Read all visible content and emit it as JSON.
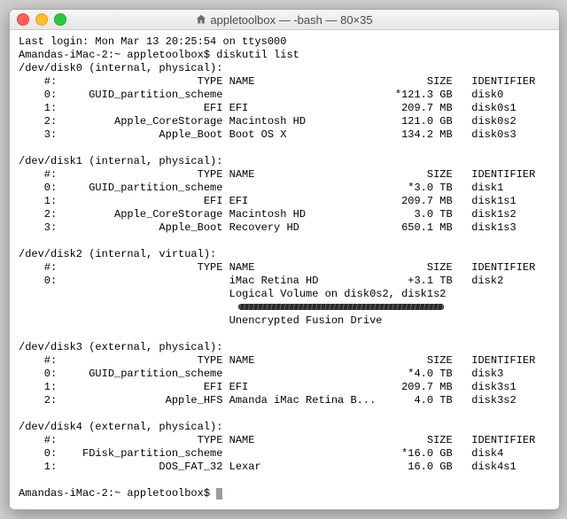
{
  "window": {
    "title": "appletoolbox — -bash — 80×35"
  },
  "login_line": "Last login: Mon Mar 13 20:25:54 on ttys000",
  "prompt_prefix": "Amandas-iMac-2:~ appletoolbox$",
  "command": "diskutil list",
  "header_cols": {
    "num": "#:",
    "type": "TYPE",
    "name": "NAME",
    "size": "SIZE",
    "ident": "IDENTIFIER"
  },
  "disks": [
    {
      "device": "/dev/disk0 (internal, physical):",
      "rows": [
        {
          "num": "0:",
          "type": "GUID_partition_scheme",
          "name": "",
          "star": "*",
          "size": "121.3 GB",
          "ident": "disk0"
        },
        {
          "num": "1:",
          "type": "EFI",
          "name": "EFI",
          "star": " ",
          "size": "209.7 MB",
          "ident": "disk0s1"
        },
        {
          "num": "2:",
          "type": "Apple_CoreStorage",
          "name": "Macintosh HD",
          "star": " ",
          "size": "121.0 GB",
          "ident": "disk0s2"
        },
        {
          "num": "3:",
          "type": "Apple_Boot",
          "name": "Boot OS X",
          "star": " ",
          "size": "134.2 MB",
          "ident": "disk0s3"
        }
      ]
    },
    {
      "device": "/dev/disk1 (internal, physical):",
      "rows": [
        {
          "num": "0:",
          "type": "GUID_partition_scheme",
          "name": "",
          "star": "*",
          "size": "3.0 TB",
          "ident": "disk1"
        },
        {
          "num": "1:",
          "type": "EFI",
          "name": "EFI",
          "star": " ",
          "size": "209.7 MB",
          "ident": "disk1s1"
        },
        {
          "num": "2:",
          "type": "Apple_CoreStorage",
          "name": "Macintosh HD",
          "star": " ",
          "size": "3.0 TB",
          "ident": "disk1s2"
        },
        {
          "num": "3:",
          "type": "Apple_Boot",
          "name": "Recovery HD",
          "star": " ",
          "size": "650.1 MB",
          "ident": "disk1s3"
        }
      ]
    },
    {
      "device": "/dev/disk2 (internal, virtual):",
      "rows": [
        {
          "num": "0:",
          "type": "",
          "name": "iMac Retina HD",
          "star": "+",
          "size": "3.1 TB",
          "ident": "disk2"
        }
      ],
      "extra": [
        "Logical Volume on disk0s2, disk1s2",
        "__SCRIBBLE__",
        "Unencrypted Fusion Drive"
      ]
    },
    {
      "device": "/dev/disk3 (external, physical):",
      "rows": [
        {
          "num": "0:",
          "type": "GUID_partition_scheme",
          "name": "",
          "star": "*",
          "size": "4.0 TB",
          "ident": "disk3"
        },
        {
          "num": "1:",
          "type": "EFI",
          "name": "EFI",
          "star": " ",
          "size": "209.7 MB",
          "ident": "disk3s1"
        },
        {
          "num": "2:",
          "type": "Apple_HFS",
          "name": "Amanda iMac Retina B...",
          "star": " ",
          "size": "4.0 TB",
          "ident": "disk3s2"
        }
      ]
    },
    {
      "device": "/dev/disk4 (external, physical):",
      "rows": [
        {
          "num": "0:",
          "type": "FDisk_partition_scheme",
          "name": "",
          "star": "*",
          "size": "16.0 GB",
          "ident": "disk4"
        },
        {
          "num": "1:",
          "type": "DOS_FAT_32",
          "name": "Lexar",
          "star": " ",
          "size": "16.0 GB",
          "ident": "disk4s1"
        }
      ]
    }
  ]
}
